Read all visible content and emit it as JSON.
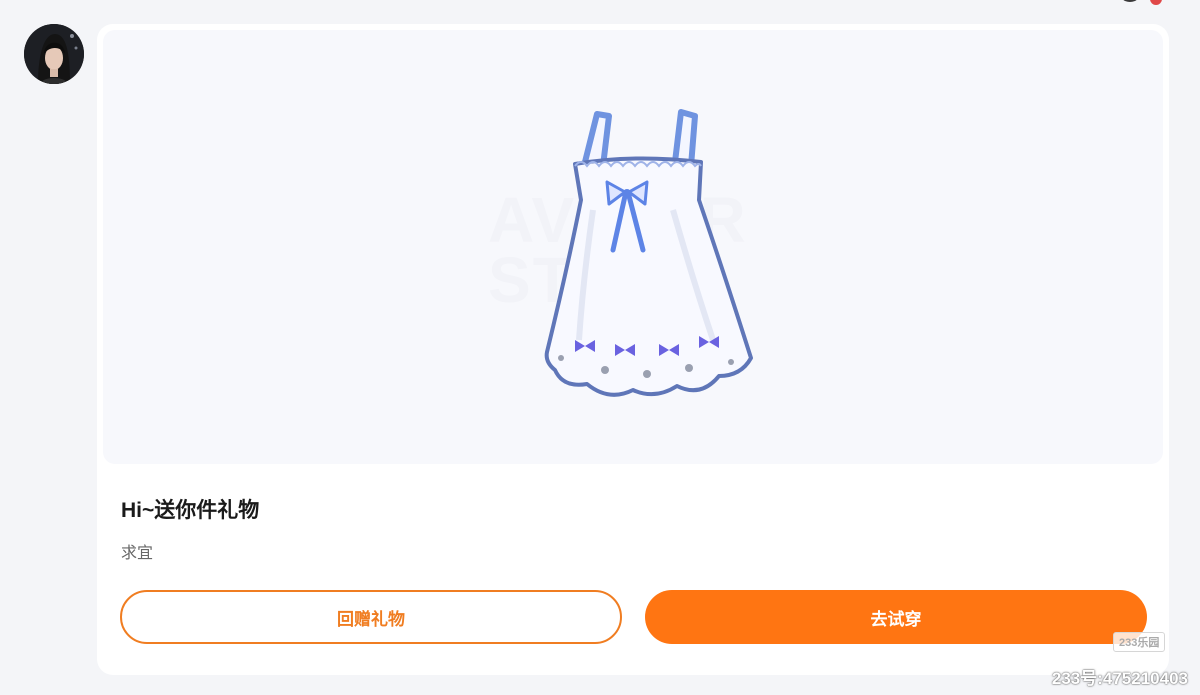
{
  "gift_card": {
    "image_watermark": "AVATAR STORE",
    "title": "Hi~送你件礼物",
    "message": "求宜",
    "return_gift_label": "回赠礼物",
    "try_on_label": "去试穿"
  },
  "watermark": {
    "logo_text": "233乐园",
    "id_text": "233号:475210403"
  },
  "colors": {
    "accent_orange": "#ff7512",
    "outline_orange": "#f07d21",
    "dress_blue": "#7b9ee6",
    "bow_purple": "#6a62e0"
  },
  "icons": {
    "sender_avatar": "avatar",
    "gift_item": "dress-icon"
  }
}
